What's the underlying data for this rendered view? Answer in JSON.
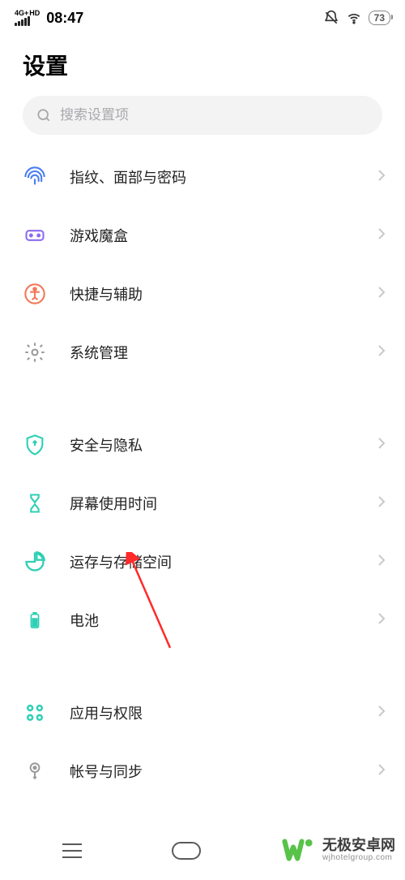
{
  "status": {
    "network": "4G+",
    "hd": "HD",
    "time": "08:47",
    "battery": "73"
  },
  "title": "设置",
  "search": {
    "placeholder": "搜索设置项"
  },
  "groups": [
    [
      {
        "id": "fingerprint",
        "label": "指纹、面部与密码",
        "icon": "fingerprint",
        "color": "#4a7fef"
      },
      {
        "id": "gamebox",
        "label": "游戏魔盒",
        "icon": "gamebox",
        "color": "#8c6cf0"
      },
      {
        "id": "shortcut",
        "label": "快捷与辅助",
        "icon": "accessibility",
        "color": "#f07a5a"
      },
      {
        "id": "system",
        "label": "系统管理",
        "icon": "gear",
        "color": "#9a9a9e"
      }
    ],
    [
      {
        "id": "security",
        "label": "安全与隐私",
        "icon": "shield",
        "color": "#2ed0b5"
      },
      {
        "id": "screentime",
        "label": "屏幕使用时间",
        "icon": "hourglass",
        "color": "#2ed0b5"
      },
      {
        "id": "storage",
        "label": "运存与存储空间",
        "icon": "pie",
        "color": "#2ed0b5"
      },
      {
        "id": "battery",
        "label": "电池",
        "icon": "battery",
        "color": "#2ed0b5"
      }
    ],
    [
      {
        "id": "apps",
        "label": "应用与权限",
        "icon": "grid",
        "color": "#2ed0b5"
      },
      {
        "id": "account",
        "label": "帐号与同步",
        "icon": "key",
        "color": "#9a9a9e"
      }
    ]
  ],
  "watermark": {
    "cn": "无极安卓网",
    "en": "wjhotelgroup.com"
  }
}
